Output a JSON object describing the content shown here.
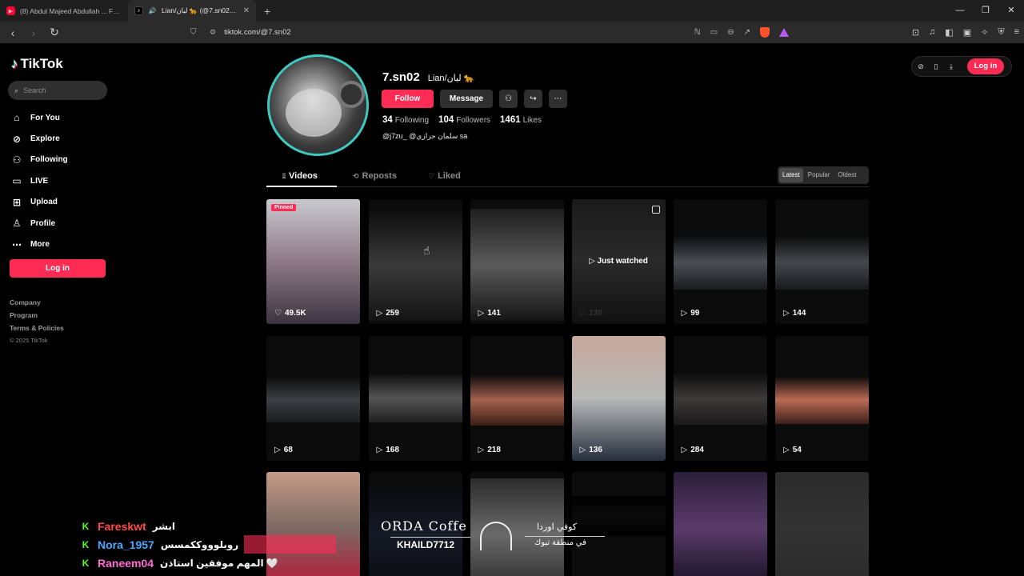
{
  "browser": {
    "tabs": [
      {
        "title": "(8) Abdul Majeed Abdullah ... Fezi Lal",
        "icon": "youtube-icon"
      },
      {
        "title": "Lian/ليان 🐆 (@7.sn02) | TikTok",
        "icon": "tiktok-icon"
      }
    ],
    "url": "tiktok.com/@7.sn02"
  },
  "sidebar": {
    "logo": "TikTok",
    "search_placeholder": "Search",
    "nav": [
      {
        "label": "For You",
        "icon": "home-icon"
      },
      {
        "label": "Explore",
        "icon": "compass-icon"
      },
      {
        "label": "Following",
        "icon": "following-icon"
      },
      {
        "label": "LIVE",
        "icon": "live-icon"
      },
      {
        "label": "Upload",
        "icon": "upload-icon"
      },
      {
        "label": "Profile",
        "icon": "profile-icon"
      },
      {
        "label": "More",
        "icon": "more-icon"
      }
    ],
    "login": "Log in",
    "footer": [
      "Company",
      "Program",
      "Terms & Policies"
    ],
    "copyright": "© 2025 TikTok"
  },
  "topbar": {
    "login": "Log in"
  },
  "profile": {
    "handle": "7.sn02",
    "nickname": "Lian/ليان 🐆",
    "follow": "Follow",
    "message": "Message",
    "following_count": "34",
    "following_label": "Following",
    "followers_count": "104",
    "followers_label": "Followers",
    "likes_count": "1461",
    "likes_label": "Likes",
    "bio": "@j7zu_ @سلمان حزازي sa"
  },
  "tabs": [
    "Videos",
    "Reposts",
    "Liked"
  ],
  "sort": [
    "Latest",
    "Popular",
    "Oldest"
  ],
  "videos": [
    {
      "views": "49.5K",
      "badge": "Pinned",
      "colors": [
        "#c9c9cf",
        "#8e7a86",
        "#3b3340"
      ]
    },
    {
      "views": "259",
      "colors": [
        "#0c0c0c",
        "#3a3a3a",
        "#141414"
      ]
    },
    {
      "views": "141",
      "colors": [
        "#1e1e1e",
        "#5a5a5a",
        "#161616"
      ]
    },
    {
      "views": "138",
      "overlay": "Just watched",
      "colors": [
        "#1a1a1a",
        "#2a2a2a",
        "#101010"
      ]
    },
    {
      "views": "99",
      "colors": [
        "#0a0a0a",
        "#4a4e55",
        "#1a1b20"
      ]
    },
    {
      "views": "144",
      "colors": [
        "#0a0a0a",
        "#44474c",
        "#191a1e"
      ]
    },
    {
      "views": "68",
      "colors": [
        "#0a0a0a",
        "#3d3f44",
        "#1b1c20"
      ]
    },
    {
      "views": "168",
      "colors": [
        "#101010",
        "#555555",
        "#202020"
      ]
    },
    {
      "views": "218",
      "colors": [
        "#0a0a0a",
        "#a3614e",
        "#3a1d16"
      ]
    },
    {
      "views": "136",
      "colors": [
        "#c6a79a",
        "#b9b9b9",
        "#262f3e"
      ]
    },
    {
      "views": "284",
      "colors": [
        "#0a0a0a",
        "#3d3a3a",
        "#1a1818"
      ]
    },
    {
      "views": "54",
      "colors": [
        "#0a0a0a",
        "#bb6a55",
        "#3c2019"
      ]
    },
    {
      "views": "",
      "colors": [
        "#c49a86",
        "#7d6a64",
        "#b21d3a"
      ]
    },
    {
      "views": "",
      "colors": [
        "#0b0b12",
        "#151a26",
        "#0b0b12"
      ]
    },
    {
      "views": "",
      "colors": [
        "#2b2b2b",
        "#6a6a6a",
        "#2a2a2a"
      ]
    },
    {
      "views": "",
      "colors": [
        "#000000",
        "#0a0a0a",
        "#000000"
      ]
    },
    {
      "views": "",
      "colors": [
        "#2b1e3a",
        "#5a3b6a",
        "#1a1426"
      ]
    },
    {
      "views": "",
      "colors": [
        "#2a2a2a",
        "#333333",
        "#2a2a2a"
      ]
    }
  ],
  "stream_overlay": {
    "chat": [
      {
        "user": "Fareskwt",
        "message": "ابشر",
        "color": "#ff4a4a"
      },
      {
        "user": "Nora_1957",
        "message": "روبلوووككمسس",
        "color": "#4aa8ff"
      },
      {
        "user": "Raneem04",
        "message": "المهم موفقين استاذن 🤍",
        "color": "#ff6ad5"
      }
    ],
    "banner_text_1": "ORDA Coffe",
    "banner_text_2": "KHAILD7712",
    "banner_ar_1": "كوفي اوردا",
    "banner_ar_2": "في منطقة تبوك"
  }
}
